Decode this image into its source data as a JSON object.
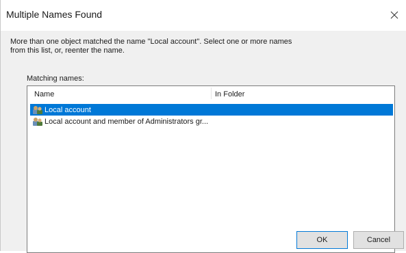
{
  "window": {
    "title": "Multiple Names Found"
  },
  "message": "More than one object matched the name \"Local account\". Select one or more names from this list, or, reenter the name.",
  "matching_names_label": "Matching names:",
  "list": {
    "columns": [
      "Name",
      "In Folder"
    ],
    "rows": [
      {
        "name": "Local account",
        "in_folder": "",
        "selected": true,
        "icon": "user-group-icon"
      },
      {
        "name": "Local account and member of Administrators gr...",
        "in_folder": "",
        "selected": false,
        "icon": "user-group-icon"
      }
    ]
  },
  "buttons": {
    "ok": "OK",
    "cancel": "Cancel"
  },
  "colors": {
    "selection": "#0078d7",
    "dialog_bg": "#f0f0f0"
  }
}
